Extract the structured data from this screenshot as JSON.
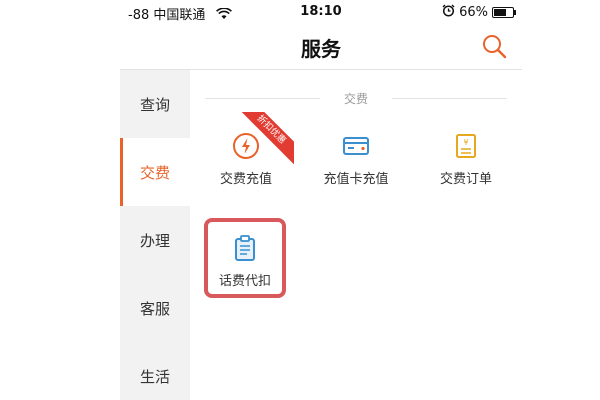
{
  "status_bar": {
    "signal_carrier": "-88 中国联通",
    "time": "18:10",
    "battery_percent_text": "66%",
    "battery_level": 0.66,
    "icons": [
      "wifi-icon",
      "alarm-icon",
      "battery-icon"
    ]
  },
  "header": {
    "title": "服务",
    "search_icon": "search-icon",
    "accent_color": "#e8622a"
  },
  "sidebar": {
    "items": [
      {
        "label": "查询",
        "active": false
      },
      {
        "label": "交费",
        "active": true
      },
      {
        "label": "办理",
        "active": false
      },
      {
        "label": "客服",
        "active": false
      },
      {
        "label": "生活",
        "active": false
      }
    ]
  },
  "main": {
    "section_title": "交费",
    "tiles": [
      {
        "label": "交费充值",
        "icon": "lightning-icon",
        "badge": "折扣优惠"
      },
      {
        "label": "充值卡充值",
        "icon": "card-icon"
      },
      {
        "label": "交费订单",
        "icon": "order-icon"
      },
      {
        "label": "话费代扣",
        "icon": "clipboard-icon",
        "highlighted": true
      }
    ]
  },
  "colors": {
    "accent": "#e8622a",
    "badge": "#e23b32",
    "highlight_border": "#d9585c",
    "blue_icon": "#3a8fd0",
    "yellow_icon": "#e6a81e",
    "sidebar_bg": "#f2f2f2"
  }
}
